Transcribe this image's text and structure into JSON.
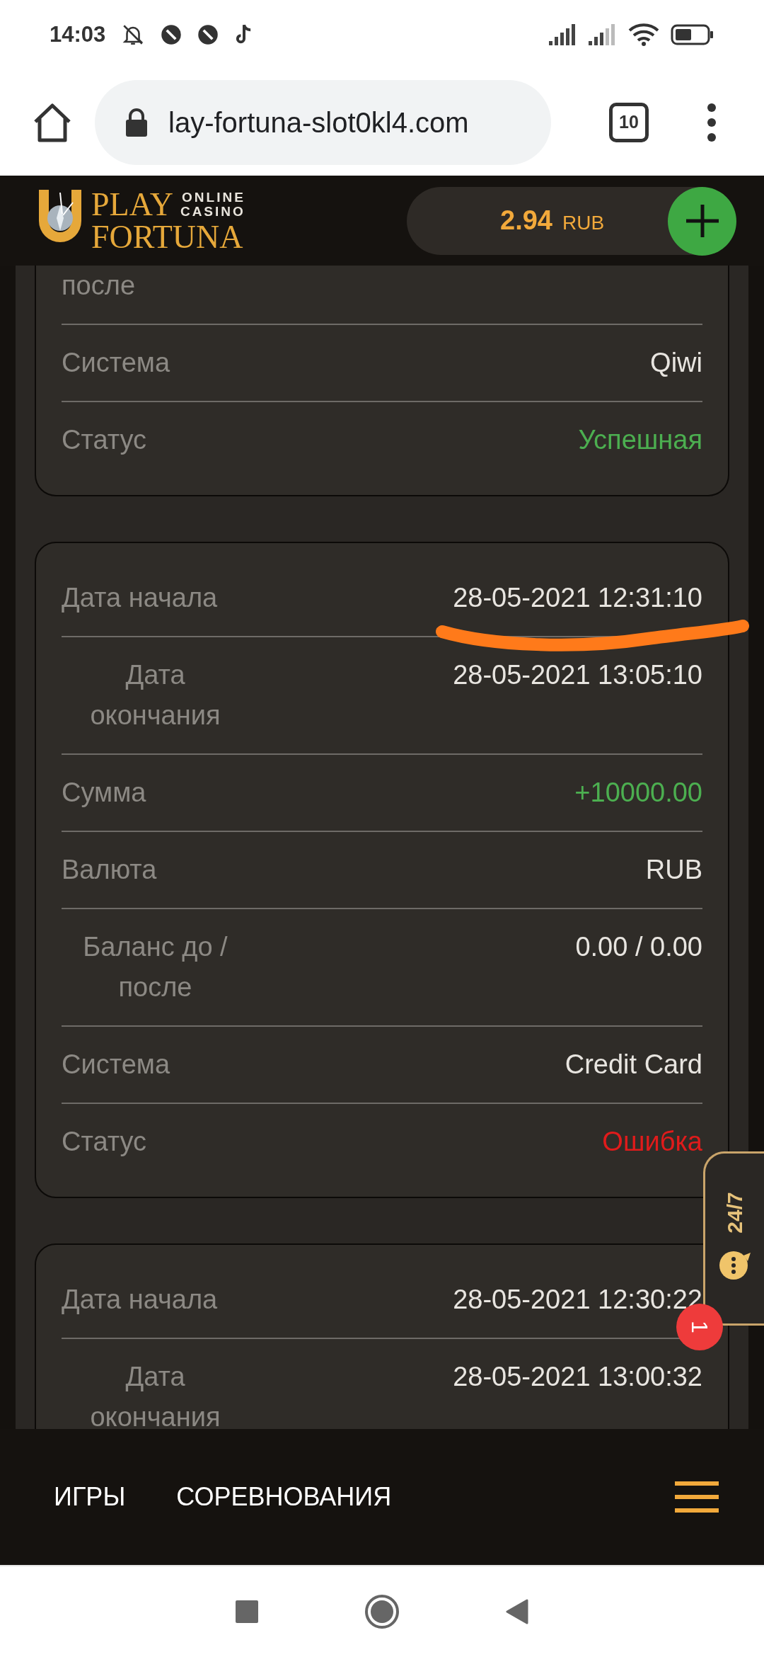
{
  "status_bar": {
    "time": "14:03"
  },
  "browser": {
    "url": "lay-fortuna-slot0kl4.com",
    "tab_count": "10"
  },
  "header": {
    "logo": {
      "word_1": "PLAY",
      "tagline_1": "ONLINE",
      "tagline_2": "CASINO",
      "word_2": "FORTUNA"
    },
    "balance": {
      "amount": "2.94",
      "currency": "RUB"
    }
  },
  "transactions": [
    {
      "cut_top": true,
      "rows": [
        {
          "label": "после"
        },
        {
          "label": "Система",
          "value": "Qiwi",
          "color": "#e8e5e0"
        },
        {
          "label": "Статус",
          "value": "Успешная",
          "color": "#4caf50"
        }
      ]
    },
    {
      "cut_top": false,
      "rows": [
        {
          "label": "Дата начала",
          "value": "28-05-2021 12:31:10",
          "color": "#e8e5e0"
        },
        {
          "label": "Дата окончания",
          "value": "28-05-2021 13:05:10",
          "color": "#e8e5e0"
        },
        {
          "label": "Сумма",
          "value": "+10000.00",
          "color": "#4caf50"
        },
        {
          "label": "Валюта",
          "value": "RUB",
          "color": "#e8e5e0"
        },
        {
          "label": "Баланс до / после",
          "value": "0.00 / 0.00",
          "color": "#e8e5e0"
        },
        {
          "label": "Система",
          "value": "Credit Card",
          "color": "#e8e5e0"
        },
        {
          "label": "Статус",
          "value": "Ошибка",
          "color": "#e01b1b"
        }
      ]
    },
    {
      "cut_top": false,
      "rows": [
        {
          "label": "Дата начала",
          "value": "28-05-2021 12:30:22",
          "color": "#e8e5e0"
        },
        {
          "label": "Дата окончания",
          "value": "28-05-2021 13:00:32",
          "color": "#e8e5e0"
        }
      ]
    }
  ],
  "support_widget": {
    "label": "24/7",
    "badge": "1"
  },
  "bottom_nav": {
    "items": [
      "ИГРЫ",
      "СОРЕВНОВАНИЯ"
    ]
  }
}
